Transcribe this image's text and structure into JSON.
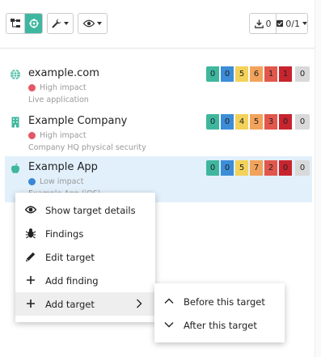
{
  "toolbar": {
    "download_count": "0",
    "checked_count": "0/1"
  },
  "targets": [
    {
      "name": "example.com",
      "icon": "globe-icon",
      "impact": "High impact",
      "impact_color": "#e45765",
      "description": "Live application",
      "counts": [
        "0",
        "0",
        "5",
        "6",
        "1",
        "1",
        "0"
      ]
    },
    {
      "name": "Example Company",
      "icon": "building-icon",
      "impact": "High impact",
      "impact_color": "#e45765",
      "description": "Company HQ physical security",
      "counts": [
        "0",
        "0",
        "4",
        "5",
        "3",
        "0",
        "0"
      ]
    },
    {
      "name": "Example App",
      "icon": "apple-icon",
      "impact": "Low impact",
      "impact_color": "#3a87d6",
      "description": "Example App (iOS)",
      "counts": [
        "0",
        "0",
        "5",
        "7",
        "2",
        "0",
        "0"
      ]
    }
  ],
  "count_colors": [
    "#3fb79e",
    "#3c8dd8",
    "#f3d25a",
    "#f2a35b",
    "#e2574c",
    "#c8242e",
    "#d9d9d9"
  ],
  "context_menu": {
    "items": [
      {
        "label": "Show target details",
        "icon": "eye-icon"
      },
      {
        "label": "Findings",
        "icon": "bug-icon"
      },
      {
        "label": "Edit target",
        "icon": "pencil-icon"
      },
      {
        "label": "Add finding",
        "icon": "plus-icon"
      },
      {
        "label": "Add target",
        "icon": "plus-icon",
        "has_submenu": true
      }
    ]
  },
  "submenu": {
    "items": [
      {
        "label": "Before this target",
        "icon": "chevron-up-icon"
      },
      {
        "label": "After this target",
        "icon": "chevron-down-icon"
      }
    ]
  }
}
